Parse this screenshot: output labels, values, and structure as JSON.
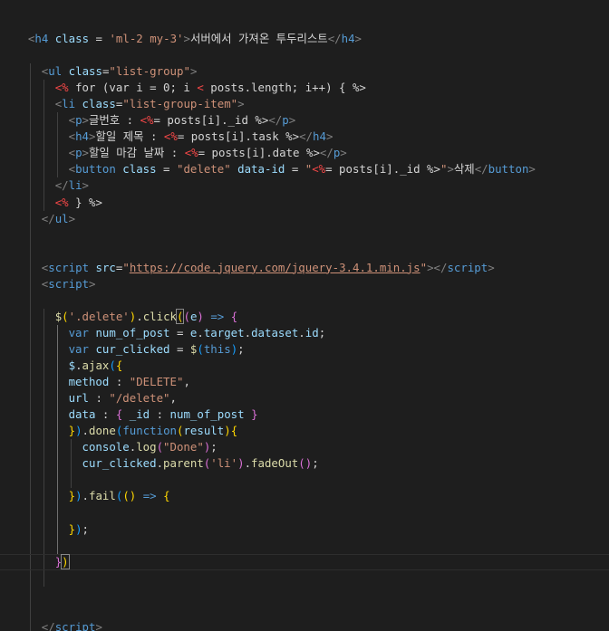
{
  "theme": {
    "background": "#1e1e1e",
    "default": "#d4d4d4",
    "tag": "#569cd6",
    "bracket": "#808080",
    "attr": "#9cdcfe",
    "string": "#ce9178",
    "function": "#dcdcaa",
    "ejs": "#c586c0",
    "ejs_tag": "#f44747",
    "brace_gold": "#ffd700",
    "brace_pink": "#da70d6",
    "brace_blue": "#179fff"
  },
  "code_lines": [
    {
      "indent": 2,
      "tokens": [
        [
          "<",
          "bracket"
        ],
        [
          "h4",
          "tag"
        ],
        [
          " class",
          "attr"
        ],
        [
          " = ",
          "default"
        ],
        [
          "'ml-2 my-3'",
          "string"
        ],
        [
          ">",
          "bracket"
        ],
        [
          "서버에서 가져온 투두리스트",
          "default"
        ],
        [
          "</",
          "bracket"
        ],
        [
          "h4",
          "tag"
        ],
        [
          ">",
          "bracket"
        ]
      ]
    },
    {
      "indent": 2,
      "tokens": []
    },
    {
      "indent": 4,
      "tokens": [
        [
          "<",
          "bracket"
        ],
        [
          "ul",
          "tag"
        ],
        [
          " class",
          "attr"
        ],
        [
          "=",
          "default"
        ],
        [
          "\"list-group\"",
          "string"
        ],
        [
          ">",
          "bracket"
        ]
      ]
    },
    {
      "indent": 6,
      "tokens": [
        [
          "<%",
          "ejs_tag"
        ],
        [
          " for (var i = 0; i ",
          "default"
        ],
        [
          "<",
          "ejs_tag"
        ],
        [
          " posts.length; i++) { ",
          "default"
        ],
        [
          "%>",
          "default"
        ]
      ]
    },
    {
      "indent": 6,
      "tokens": [
        [
          "<",
          "bracket"
        ],
        [
          "li",
          "tag"
        ],
        [
          " class",
          "attr"
        ],
        [
          "=",
          "default"
        ],
        [
          "\"list-group-item\"",
          "string"
        ],
        [
          ">",
          "bracket"
        ]
      ]
    },
    {
      "indent": 8,
      "tokens": [
        [
          "<",
          "bracket"
        ],
        [
          "p",
          "tag"
        ],
        [
          ">",
          "bracket"
        ],
        [
          "글번호 : ",
          "default"
        ],
        [
          "<%",
          "ejs_tag"
        ],
        [
          "= posts[i]._id ",
          "default"
        ],
        [
          "%>",
          "default"
        ],
        [
          "</",
          "bracket"
        ],
        [
          "p",
          "tag"
        ],
        [
          ">",
          "bracket"
        ]
      ]
    },
    {
      "indent": 8,
      "tokens": [
        [
          "<",
          "bracket"
        ],
        [
          "h4",
          "tag"
        ],
        [
          ">",
          "bracket"
        ],
        [
          "할일 제목 : ",
          "default"
        ],
        [
          "<%",
          "ejs_tag"
        ],
        [
          "= posts[i].task ",
          "default"
        ],
        [
          "%>",
          "default"
        ],
        [
          "</",
          "bracket"
        ],
        [
          "h4",
          "tag"
        ],
        [
          ">",
          "bracket"
        ]
      ]
    },
    {
      "indent": 8,
      "tokens": [
        [
          "<",
          "bracket"
        ],
        [
          "p",
          "tag"
        ],
        [
          ">",
          "bracket"
        ],
        [
          "할일 마감 날짜 : ",
          "default"
        ],
        [
          "<%",
          "ejs_tag"
        ],
        [
          "= posts[i].date ",
          "default"
        ],
        [
          "%>",
          "default"
        ],
        [
          "</",
          "bracket"
        ],
        [
          "p",
          "tag"
        ],
        [
          ">",
          "bracket"
        ]
      ]
    },
    {
      "indent": 8,
      "tokens": [
        [
          "<",
          "bracket"
        ],
        [
          "button",
          "tag"
        ],
        [
          " class",
          "attr"
        ],
        [
          " = ",
          "default"
        ],
        [
          "\"delete\"",
          "string"
        ],
        [
          " data-id",
          "attr"
        ],
        [
          " = ",
          "default"
        ],
        [
          "\"",
          "string"
        ],
        [
          "<%",
          "ejs_tag"
        ],
        [
          "= posts[i]._id ",
          "default"
        ],
        [
          "%>",
          "default"
        ],
        [
          "\"",
          "string"
        ],
        [
          ">",
          "bracket"
        ],
        [
          "삭제",
          "default"
        ],
        [
          "</",
          "bracket"
        ],
        [
          "button",
          "tag"
        ],
        [
          ">",
          "bracket"
        ]
      ]
    },
    {
      "indent": 6,
      "tokens": [
        [
          "</",
          "bracket"
        ],
        [
          "li",
          "tag"
        ],
        [
          ">",
          "bracket"
        ]
      ]
    },
    {
      "indent": 6,
      "tokens": [
        [
          "<%",
          "ejs_tag"
        ],
        [
          " } ",
          "default"
        ],
        [
          "%>",
          "default"
        ]
      ]
    },
    {
      "indent": 4,
      "tokens": [
        [
          "</",
          "bracket"
        ],
        [
          "ul",
          "tag"
        ],
        [
          ">",
          "bracket"
        ]
      ]
    },
    {
      "indent": 4,
      "tokens": []
    },
    {
      "indent": 4,
      "tokens": []
    },
    {
      "indent": 4,
      "tokens": [
        [
          "<",
          "bracket"
        ],
        [
          "script",
          "tag"
        ],
        [
          " src",
          "attr"
        ],
        [
          "=",
          "default"
        ],
        [
          "\"",
          "string"
        ],
        [
          "https://code.jquery.com/jquery-3.4.1.min.js",
          "string_underline"
        ],
        [
          "\"",
          "string"
        ],
        [
          ">",
          "bracket"
        ],
        [
          "</",
          "bracket"
        ],
        [
          "script",
          "tag"
        ],
        [
          ">",
          "bracket"
        ]
      ]
    },
    {
      "indent": 4,
      "tokens": [
        [
          "<",
          "bracket"
        ],
        [
          "script",
          "tag"
        ],
        [
          ">",
          "bracket"
        ]
      ]
    },
    {
      "indent": 4,
      "tokens": []
    },
    {
      "indent": 6,
      "tokens": [
        [
          "$",
          "function"
        ],
        [
          "(",
          "brace_gold"
        ],
        [
          "'.delete'",
          "string"
        ],
        [
          ")",
          "brace_gold"
        ],
        [
          ".",
          "default"
        ],
        [
          "click",
          "function"
        ],
        [
          "(",
          "brace_gold_box"
        ],
        [
          "(",
          "brace_pink"
        ],
        [
          "e",
          "attr"
        ],
        [
          ")",
          "brace_pink"
        ],
        [
          " => ",
          "tag"
        ],
        [
          "{",
          "brace_pink"
        ]
      ]
    },
    {
      "indent": 8,
      "tokens": [
        [
          "var",
          "tag"
        ],
        [
          " num_of_post",
          "attr"
        ],
        [
          " = ",
          "default"
        ],
        [
          "e",
          "attr"
        ],
        [
          ".",
          "default"
        ],
        [
          "target",
          "attr"
        ],
        [
          ".",
          "default"
        ],
        [
          "dataset",
          "attr"
        ],
        [
          ".",
          "default"
        ],
        [
          "id",
          "attr"
        ],
        [
          ";",
          "default"
        ]
      ]
    },
    {
      "indent": 8,
      "tokens": [
        [
          "var",
          "tag"
        ],
        [
          " cur_clicked",
          "attr"
        ],
        [
          " = ",
          "default"
        ],
        [
          "$",
          "function"
        ],
        [
          "(",
          "brace_blue"
        ],
        [
          "this",
          "tag"
        ],
        [
          ")",
          "brace_blue"
        ],
        [
          ";",
          "default"
        ]
      ]
    },
    {
      "indent": 8,
      "tokens": [
        [
          "$",
          "attr"
        ],
        [
          ".",
          "default"
        ],
        [
          "ajax",
          "function"
        ],
        [
          "(",
          "brace_blue"
        ],
        [
          "{",
          "brace_gold"
        ]
      ]
    },
    {
      "indent": 8,
      "tokens": [
        [
          "method",
          "attr"
        ],
        [
          " : ",
          "default"
        ],
        [
          "\"DELETE\"",
          "string"
        ],
        [
          ",",
          "default"
        ]
      ]
    },
    {
      "indent": 8,
      "tokens": [
        [
          "url",
          "attr"
        ],
        [
          " : ",
          "default"
        ],
        [
          "\"/delete\"",
          "string"
        ],
        [
          ",",
          "default"
        ]
      ]
    },
    {
      "indent": 8,
      "tokens": [
        [
          "data",
          "attr"
        ],
        [
          " : ",
          "default"
        ],
        [
          "{",
          "brace_pink"
        ],
        [
          " _id",
          "attr"
        ],
        [
          " : ",
          "default"
        ],
        [
          "num_of_post",
          "attr"
        ],
        [
          " ",
          "default"
        ],
        [
          "}",
          "brace_pink"
        ]
      ]
    },
    {
      "indent": 8,
      "tokens": [
        [
          "}",
          "brace_gold"
        ],
        [
          ")",
          "brace_blue"
        ],
        [
          ".",
          "default"
        ],
        [
          "done",
          "function"
        ],
        [
          "(",
          "brace_blue"
        ],
        [
          "function",
          "tag"
        ],
        [
          "(",
          "brace_gold"
        ],
        [
          "result",
          "attr"
        ],
        [
          ")",
          "brace_gold"
        ],
        [
          "{",
          "brace_gold"
        ]
      ]
    },
    {
      "indent": 10,
      "tokens": [
        [
          "console",
          "attr"
        ],
        [
          ".",
          "default"
        ],
        [
          "log",
          "function"
        ],
        [
          "(",
          "brace_pink"
        ],
        [
          "\"Done\"",
          "string"
        ],
        [
          ")",
          "brace_pink"
        ],
        [
          ";",
          "default"
        ]
      ]
    },
    {
      "indent": 10,
      "tokens": [
        [
          "cur_clicked",
          "attr"
        ],
        [
          ".",
          "default"
        ],
        [
          "parent",
          "function"
        ],
        [
          "(",
          "brace_pink"
        ],
        [
          "'li'",
          "string"
        ],
        [
          ")",
          "brace_pink"
        ],
        [
          ".",
          "default"
        ],
        [
          "fadeOut",
          "function"
        ],
        [
          "(",
          "brace_pink"
        ],
        [
          ")",
          "brace_pink"
        ],
        [
          ";",
          "default"
        ]
      ]
    },
    {
      "indent": 10,
      "tokens": []
    },
    {
      "indent": 8,
      "tokens": [
        [
          "}",
          "brace_gold"
        ],
        [
          ")",
          "brace_blue"
        ],
        [
          ".",
          "default"
        ],
        [
          "fail",
          "function"
        ],
        [
          "(",
          "brace_blue"
        ],
        [
          "(",
          "brace_gold"
        ],
        [
          ")",
          "brace_gold"
        ],
        [
          " => ",
          "tag"
        ],
        [
          "{",
          "brace_gold"
        ]
      ]
    },
    {
      "indent": 8,
      "tokens": []
    },
    {
      "indent": 8,
      "tokens": [
        [
          "}",
          "brace_gold"
        ],
        [
          ")",
          "brace_blue"
        ],
        [
          ";",
          "default"
        ]
      ]
    },
    {
      "indent": 8,
      "tokens": []
    },
    {
      "indent": 6,
      "tokens": [
        [
          "}",
          "brace_pink"
        ],
        [
          ")",
          "brace_gold_box"
        ]
      ]
    },
    {
      "indent": 6,
      "tokens": []
    },
    {
      "indent": 4,
      "tokens": []
    },
    {
      "indent": 4,
      "tokens": []
    },
    {
      "indent": 4,
      "tokens": [
        [
          "</",
          "bracket"
        ],
        [
          "script",
          "tag"
        ],
        [
          ">",
          "bracket"
        ]
      ]
    }
  ]
}
